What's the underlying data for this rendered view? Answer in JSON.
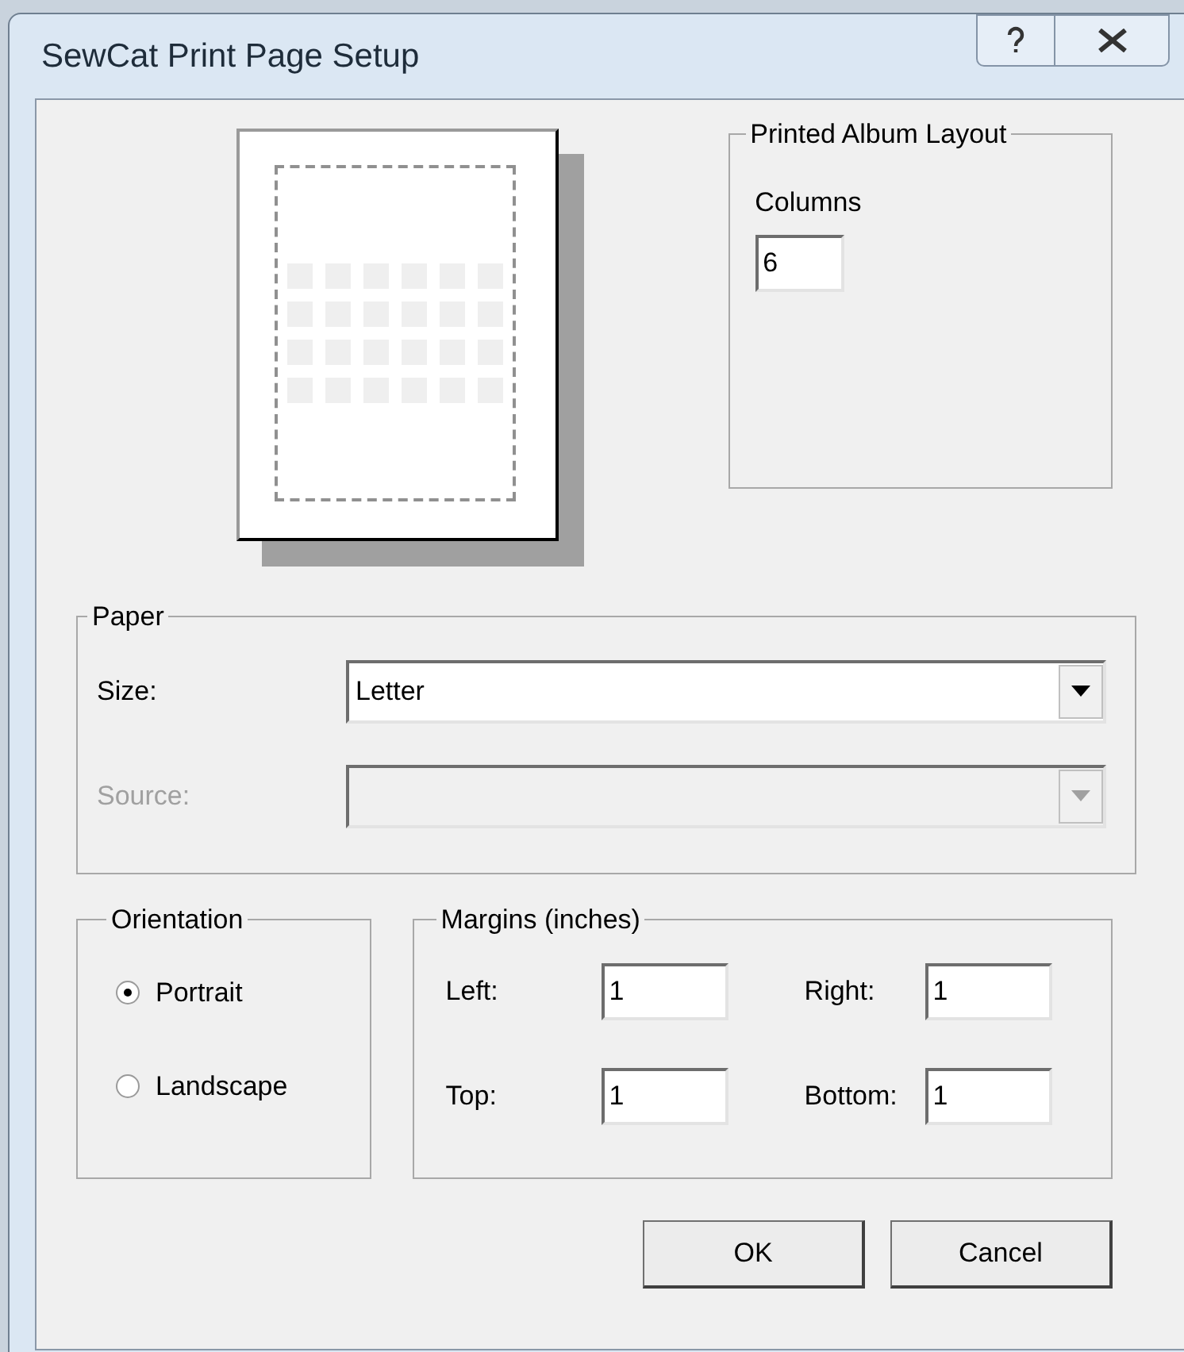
{
  "window": {
    "title": "SewCat Print Page Setup"
  },
  "album_layout": {
    "title": "Printed Album Layout",
    "columns_label": "Columns",
    "columns_value": "6"
  },
  "paper": {
    "title": "Paper",
    "size_label": "Size:",
    "size_value": "Letter",
    "source_label": "Source:",
    "source_disabled": true
  },
  "orientation": {
    "title": "Orientation",
    "options": [
      {
        "label": "Portrait",
        "selected": true
      },
      {
        "label": "Landscape",
        "selected": false
      }
    ]
  },
  "margins": {
    "title": "Margins (inches)",
    "fields": [
      {
        "label": "Left:",
        "value": "1"
      },
      {
        "label": "Right:",
        "value": "1"
      },
      {
        "label": "Top:",
        "value": "1"
      },
      {
        "label": "Bottom:",
        "value": "1"
      }
    ]
  },
  "buttons": [
    "OK",
    "Cancel"
  ]
}
